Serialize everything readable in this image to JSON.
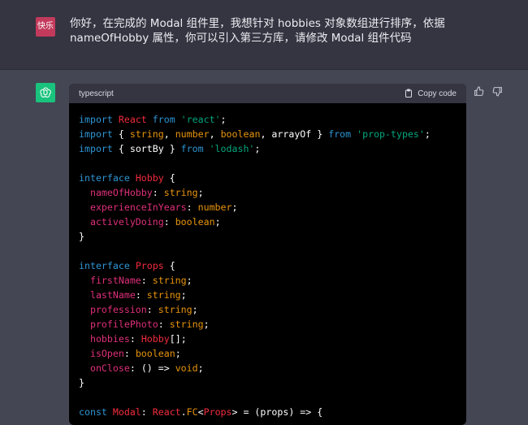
{
  "user_message": {
    "avatar_text": "快乐",
    "text": "你好，在完成的 Modal 组件里，我想针对 hobbies 对象数组进行排序，依据 nameOfHobby 属性，你可以引入第三方库，请修改 Modal 组件代码"
  },
  "assistant": {
    "avatar_icon": "openai-logo-icon",
    "code_block": {
      "language": "typescript",
      "copy_label": "Copy code",
      "lines": [
        [
          [
            "kw",
            "import "
          ],
          [
            "cls",
            "React "
          ],
          [
            "kw",
            "from "
          ],
          [
            "str",
            "'react'"
          ],
          [
            "",
            "; "
          ]
        ],
        [
          [
            "kw",
            "import "
          ],
          [
            "",
            "{ "
          ],
          [
            "type",
            "string"
          ],
          [
            ", "
          ],
          [
            "type",
            "number"
          ],
          [
            ", "
          ],
          [
            "type",
            "boolean"
          ],
          [
            ", "
          ],
          [
            "",
            "arrayOf "
          ],
          [
            "",
            "} "
          ],
          [
            "kw",
            "from "
          ],
          [
            "str",
            "'prop-types'"
          ],
          [
            ";"
          ]
        ],
        [
          [
            "kw",
            "import "
          ],
          [
            "",
            "{ sortBy } "
          ],
          [
            "kw",
            "from "
          ],
          [
            "str",
            "'lodash'"
          ],
          [
            ";"
          ]
        ],
        [
          [
            ""
          ]
        ],
        [
          [
            "kw",
            "interface "
          ],
          [
            "cls",
            "Hobby "
          ],
          [
            "",
            "{"
          ]
        ],
        [
          [
            "",
            "  "
          ],
          [
            "prop",
            "nameOfHobby"
          ],
          [
            ": "
          ],
          [
            "type",
            "string"
          ],
          [
            ";"
          ]
        ],
        [
          [
            "",
            "  "
          ],
          [
            "prop",
            "experienceInYears"
          ],
          [
            ": "
          ],
          [
            "type",
            "number"
          ],
          [
            ";"
          ]
        ],
        [
          [
            "",
            "  "
          ],
          [
            "prop",
            "activelyDoing"
          ],
          [
            ": "
          ],
          [
            "type",
            "boolean"
          ],
          [
            ";"
          ]
        ],
        [
          [
            "",
            "}"
          ]
        ],
        [
          [
            ""
          ]
        ],
        [
          [
            "kw",
            "interface "
          ],
          [
            "cls",
            "Props "
          ],
          [
            "",
            "{"
          ]
        ],
        [
          [
            "",
            "  "
          ],
          [
            "prop",
            "firstName"
          ],
          [
            ": "
          ],
          [
            "type",
            "string"
          ],
          [
            ";"
          ]
        ],
        [
          [
            "",
            "  "
          ],
          [
            "prop",
            "lastName"
          ],
          [
            ": "
          ],
          [
            "type",
            "string"
          ],
          [
            ";"
          ]
        ],
        [
          [
            "",
            "  "
          ],
          [
            "prop",
            "profession"
          ],
          [
            ": "
          ],
          [
            "type",
            "string"
          ],
          [
            ";"
          ]
        ],
        [
          [
            "",
            "  "
          ],
          [
            "prop",
            "profilePhoto"
          ],
          [
            ": "
          ],
          [
            "type",
            "string"
          ],
          [
            ";"
          ]
        ],
        [
          [
            "",
            "  "
          ],
          [
            "prop",
            "hobbies"
          ],
          [
            ": "
          ],
          [
            "cls",
            "Hobby"
          ],
          [
            "",
            "[]"
          ],
          [
            ";"
          ]
        ],
        [
          [
            "",
            "  "
          ],
          [
            "prop",
            "isOpen"
          ],
          [
            ": "
          ],
          [
            "type",
            "boolean"
          ],
          [
            ";"
          ]
        ],
        [
          [
            "",
            "  "
          ],
          [
            "prop",
            "onClose"
          ],
          [
            ": "
          ],
          [
            "",
            "() => "
          ],
          [
            "type",
            "void"
          ],
          [
            ";"
          ]
        ],
        [
          [
            "",
            "}"
          ]
        ],
        [
          [
            ""
          ]
        ],
        [
          [
            "kw",
            "const "
          ],
          [
            "cls",
            "Modal"
          ],
          [
            ": "
          ],
          [
            "cls",
            "React"
          ],
          [
            "",
            "."
          ],
          [
            "fn",
            "FC"
          ],
          [
            "",
            "<"
          ],
          [
            "cls",
            "Props"
          ],
          [
            "",
            "> = (props) => {"
          ]
        ]
      ]
    }
  },
  "feedback": {
    "thumbs_up_icon": "thumbs-up-icon",
    "thumbs_down_icon": "thumbs-down-icon"
  }
}
